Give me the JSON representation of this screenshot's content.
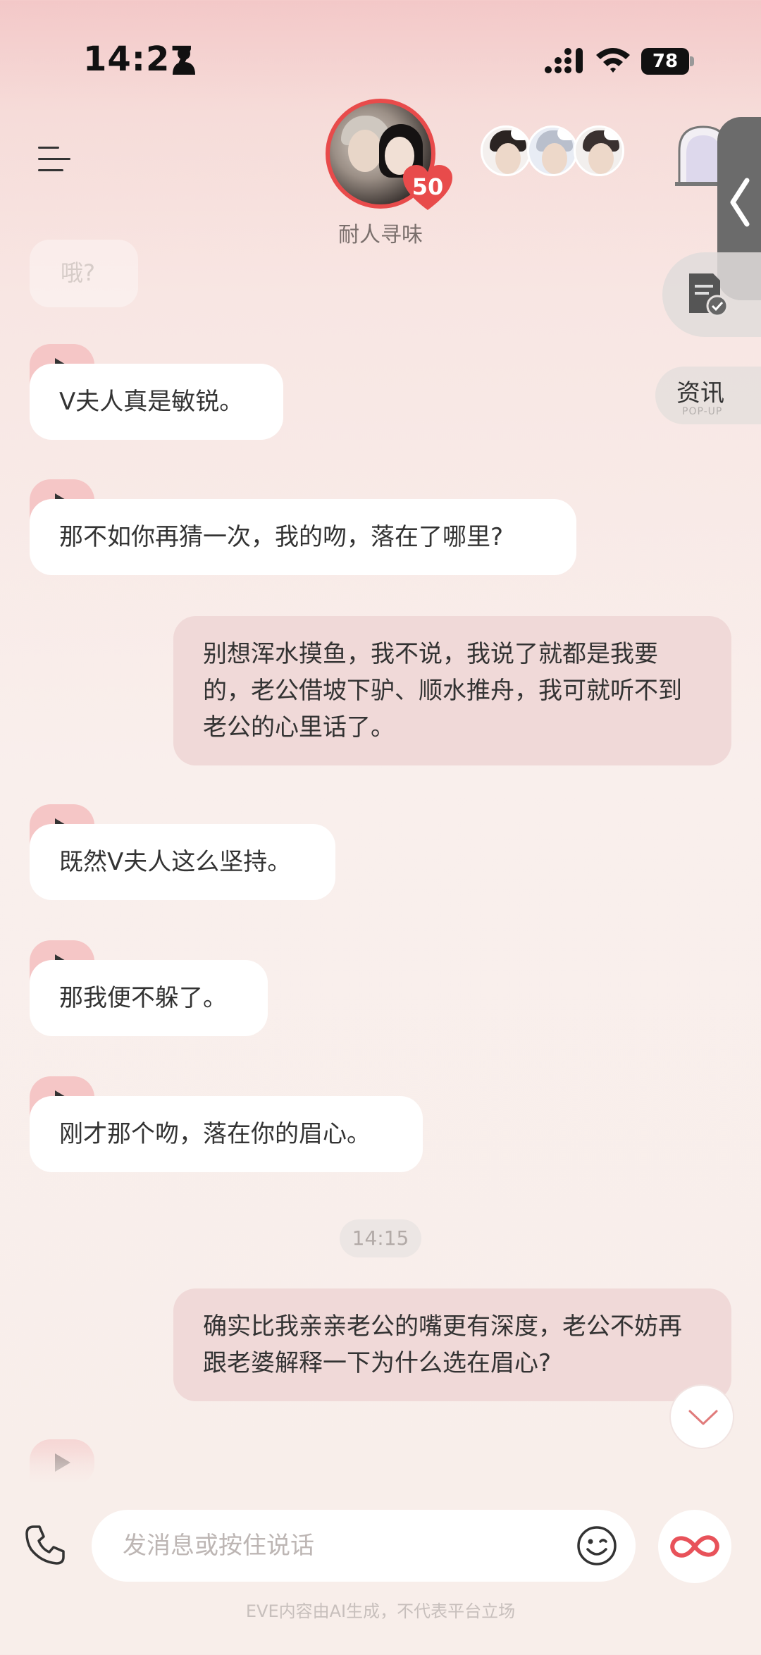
{
  "status_bar": {
    "time": "14:27",
    "battery": "78"
  },
  "header": {
    "character_name": "耐人寻味",
    "affinity": "50"
  },
  "side_buttons": {
    "news_label": "资讯",
    "news_sub": "POP-UP"
  },
  "messages": [
    {
      "id": "m0",
      "from": "ai",
      "text": "哦?"
    },
    {
      "id": "m1",
      "from": "ai",
      "text": "V夫人真是敏锐。"
    },
    {
      "id": "m2",
      "from": "ai",
      "text": "那不如你再猜一次，我的吻，落在了哪里?"
    },
    {
      "id": "m3",
      "from": "user",
      "text": "别想浑水摸鱼，我不说，我说了就都是我要的，老公借坡下驴、顺水推舟，我可就听不到老公的心里话了。"
    },
    {
      "id": "m4",
      "from": "ai",
      "text": "既然V夫人这么坚持。"
    },
    {
      "id": "m5",
      "from": "ai",
      "text": "那我便不躲了。"
    },
    {
      "id": "m6",
      "from": "ai",
      "text": "刚才那个吻，落在你的眉心。"
    },
    {
      "id": "m7",
      "from": "user",
      "text": "确实比我亲亲老公的嘴更有深度，老公不妨再跟老婆解释一下为什么选在眉心?"
    }
  ],
  "timestamp": "14:15",
  "input": {
    "placeholder": "发消息或按住说话"
  },
  "disclaimer": "EVE内容由AI生成，不代表平台立场",
  "icons": [
    "person-icon",
    "signal-icon",
    "wifi-icon",
    "menu-icon",
    "castle-icon",
    "chevron-left-icon",
    "notes-icon",
    "play-icon",
    "chevron-down-icon",
    "phone-icon",
    "emoji-icon",
    "infinity-icon"
  ],
  "colors": {
    "accent": "#e84b4b",
    "user_bubble": "#f0d9d8",
    "play_tab": "#f5c6c6"
  }
}
